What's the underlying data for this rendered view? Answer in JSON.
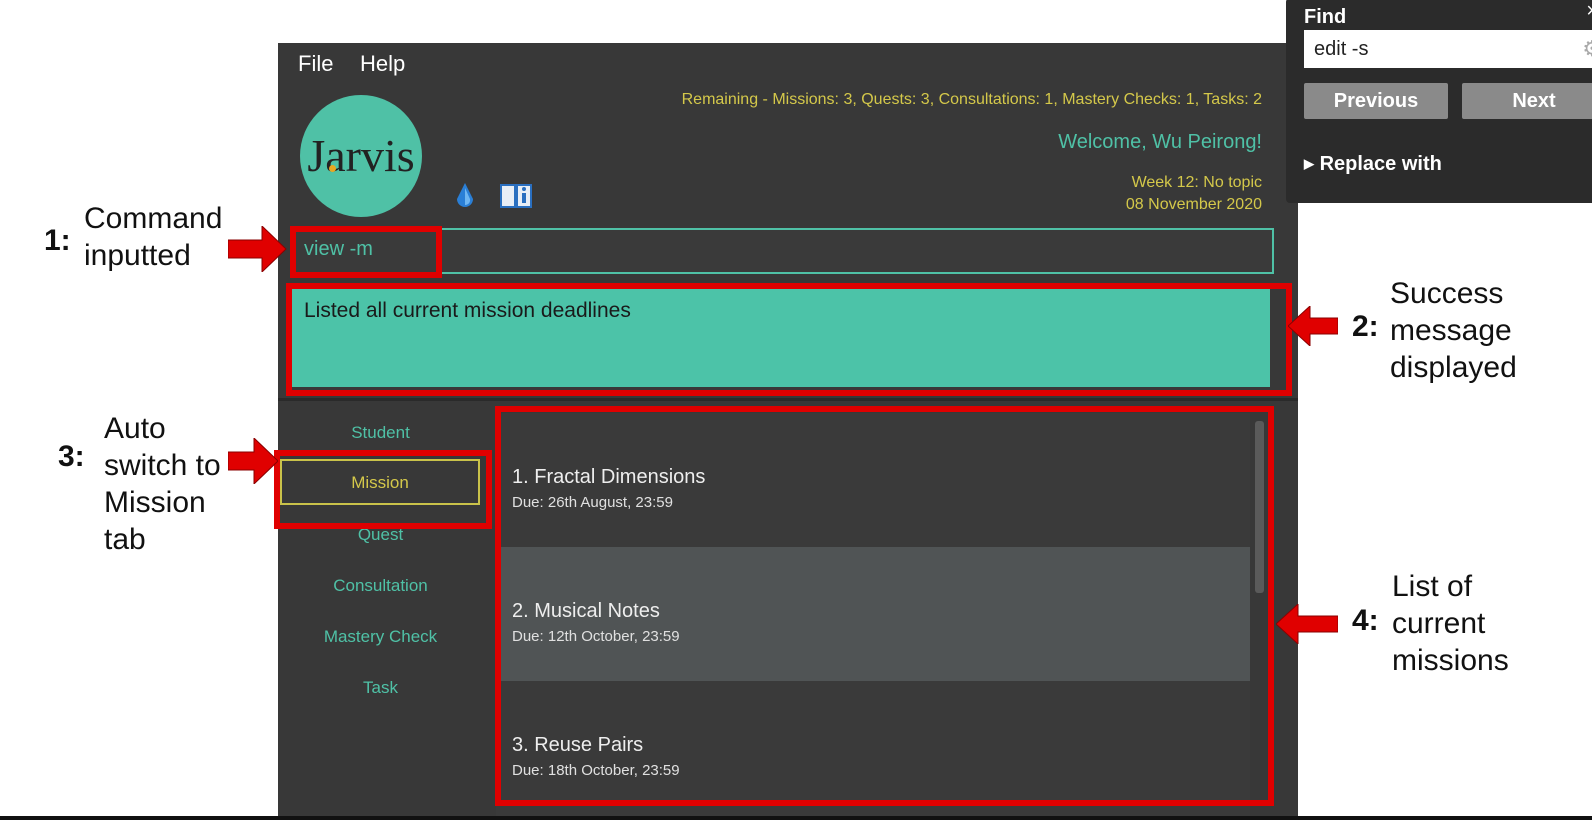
{
  "menubar": {
    "file": "File",
    "help": "Help"
  },
  "header": {
    "remaining": "Remaining - Missions: 3, Quests: 3, Consultations: 1, Mastery Checks: 1, Tasks: 2",
    "welcome": "Welcome, Wu Peirong!",
    "week": "Week 12: No topic",
    "date": "08 November 2020",
    "logo_text": "Jarvis"
  },
  "command": {
    "value": "view -m"
  },
  "result": {
    "message": "Listed all current mission deadlines"
  },
  "tabs": [
    {
      "label": "Student",
      "active": false
    },
    {
      "label": "Mission",
      "active": true
    },
    {
      "label": "Quest",
      "active": false
    },
    {
      "label": "Consultation",
      "active": false
    },
    {
      "label": "Mastery Check",
      "active": false
    },
    {
      "label": "Task",
      "active": false
    }
  ],
  "missions": [
    {
      "title": "1.  Fractal Dimensions",
      "due": "Due: 26th August, 23:59"
    },
    {
      "title": "2.  Musical Notes",
      "due": "Due: 12th October, 23:59"
    },
    {
      "title": "3.  Reuse Pairs",
      "due": "Due: 18th October, 23:59"
    }
  ],
  "annotations": [
    {
      "num": "1:",
      "text": [
        "Command",
        "inputted"
      ]
    },
    {
      "num": "2:",
      "text": [
        "Success",
        "message",
        "displayed"
      ]
    },
    {
      "num": "3:",
      "text": [
        "Auto",
        "switch to",
        "Mission",
        "tab"
      ]
    },
    {
      "num": "4:",
      "text": [
        "List of",
        "current",
        "missions"
      ]
    }
  ],
  "find": {
    "title": "Find",
    "close": "×",
    "query": "edit -s",
    "previous": "Previous",
    "next": "Next",
    "replace_with": "Replace with"
  },
  "icons": {
    "logo": "jarvis-logo",
    "drop": "drop-icon",
    "book": "book-info-icon",
    "gear": "gear-icon"
  },
  "colors": {
    "accent": "#4fc1a6",
    "highlight": "#d4c84a",
    "annotation": "#e00000",
    "background": "#383838"
  }
}
